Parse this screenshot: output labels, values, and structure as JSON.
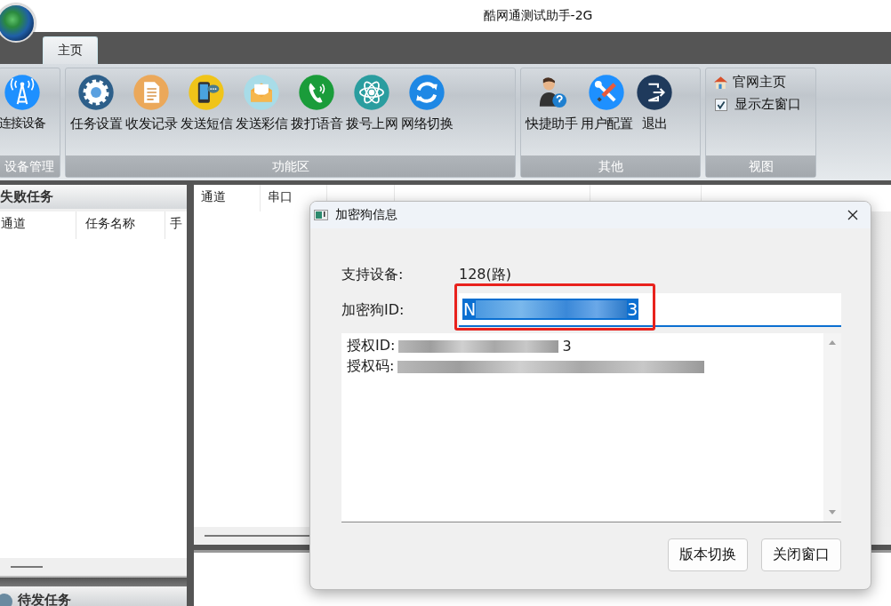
{
  "window": {
    "title": "酷网通测试助手-2G"
  },
  "tabs": [
    {
      "label": "主页",
      "selected": true
    }
  ],
  "ribbon": {
    "groups": [
      {
        "label": "设备管理",
        "items": [
          {
            "kind": "big",
            "label": "连接设备"
          }
        ]
      },
      {
        "label": "功能区",
        "items": [
          {
            "kind": "big",
            "label": "任务设置"
          },
          {
            "kind": "big",
            "label": "收发记录"
          },
          {
            "kind": "big",
            "label": "发送短信"
          },
          {
            "kind": "big",
            "label": "发送彩信"
          },
          {
            "kind": "big",
            "label": "拨打语音"
          },
          {
            "kind": "big",
            "label": "拨号上网"
          },
          {
            "kind": "big",
            "label": "网络切换"
          }
        ]
      },
      {
        "label": "其他",
        "items": [
          {
            "kind": "big",
            "label": "快捷助手"
          },
          {
            "kind": "big",
            "label": "用户配置"
          },
          {
            "kind": "big",
            "label": "退出"
          }
        ]
      },
      {
        "label": "视图",
        "items": [
          {
            "kind": "link",
            "label": "官网主页"
          },
          {
            "kind": "check",
            "label": "显示左窗口",
            "checked": true
          }
        ]
      }
    ]
  },
  "left_panel": {
    "title": "失败任务",
    "columns": [
      "通道",
      "任务名称",
      "手"
    ],
    "bottom_title": "待发任务"
  },
  "main_table": {
    "columns": [
      "通道",
      "串口"
    ]
  },
  "dialog": {
    "title": "加密狗信息",
    "rows": [
      {
        "label": "支持设备:",
        "value": "128(路)"
      }
    ],
    "id_field": {
      "label": "加密狗ID:",
      "value_start": "N",
      "value_end": "3"
    },
    "info_lines": [
      {
        "label": "授权ID:",
        "tail": "3"
      },
      {
        "label": "授权码:"
      }
    ],
    "buttons": [
      "版本切换",
      "关闭窗口"
    ]
  }
}
